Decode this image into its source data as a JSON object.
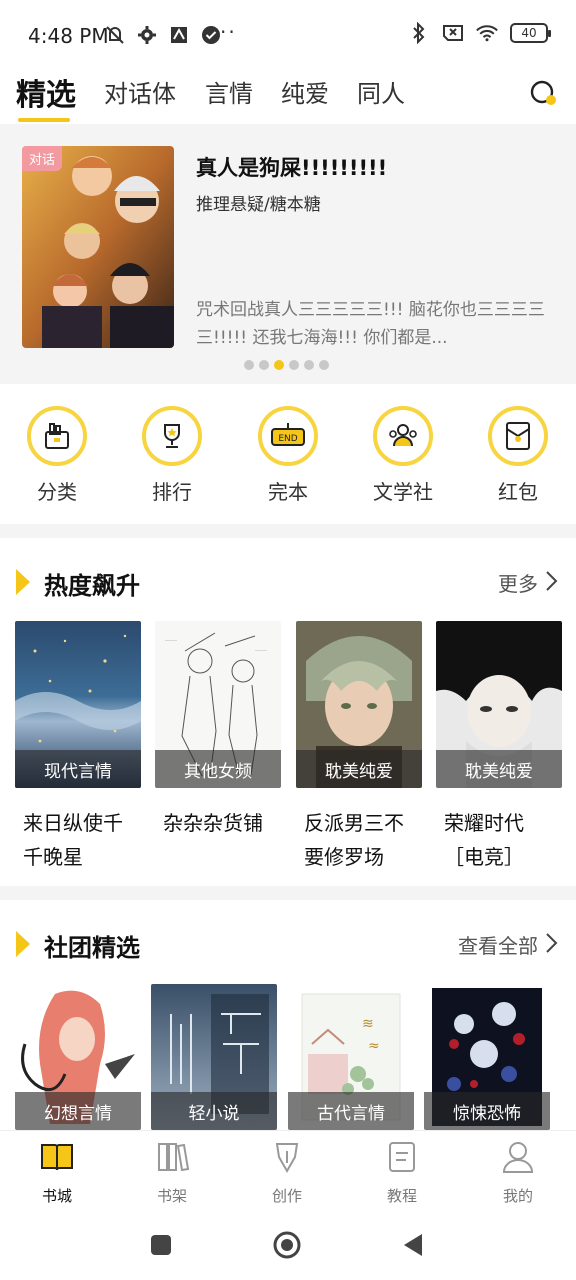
{
  "status_bar": {
    "time": "4:48 PM",
    "battery": "40",
    "more": "··"
  },
  "tabs": [
    {
      "label": "精选",
      "active": true
    },
    {
      "label": "对话体"
    },
    {
      "label": "言情"
    },
    {
      "label": "纯爱"
    },
    {
      "label": "同人"
    }
  ],
  "banner": {
    "tag": "对话",
    "title": "真人是狗屎!!!!!!!!!",
    "subtitle": "推理悬疑/糖本糖",
    "description": "咒术回战真人三三三三三!!! 脑花你也三三三三三!!!!! 还我七海海!!! 你们都是...",
    "page_count": 6,
    "active_page": 2
  },
  "quick_entries": [
    {
      "label": "分类",
      "icon": "category-bag-icon"
    },
    {
      "label": "排行",
      "icon": "trophy-icon"
    },
    {
      "label": "完本",
      "icon": "end-sign-icon"
    },
    {
      "label": "文学社",
      "icon": "club-people-icon"
    },
    {
      "label": "红包",
      "icon": "red-envelope-icon"
    }
  ],
  "hot_section": {
    "title": "热度飙升",
    "more": "更多",
    "books": [
      {
        "category": "现代言情",
        "title": "来日纵使千千晚星"
      },
      {
        "category": "其他女频",
        "title": "杂杂杂货铺"
      },
      {
        "category": "耽美纯爱",
        "title": "反派男三不要修罗场"
      },
      {
        "category": "耽美纯爱",
        "title": "荣耀时代［电竞］"
      }
    ]
  },
  "club_section": {
    "title": "社团精选",
    "more": "查看全部",
    "books": [
      {
        "category": "幻想言情"
      },
      {
        "category": "轻小说"
      },
      {
        "category": "古代言情"
      },
      {
        "category": "惊悚恐怖"
      }
    ]
  },
  "bottom_nav": [
    {
      "label": "书城",
      "active": true,
      "icon": "book-open-icon"
    },
    {
      "label": "书架",
      "icon": "bookshelf-icon"
    },
    {
      "label": "创作",
      "icon": "pen-icon"
    },
    {
      "label": "教程",
      "icon": "document-icon"
    },
    {
      "label": "我的",
      "icon": "person-icon"
    }
  ],
  "colors": {
    "accent": "#f5c518",
    "tag_pink": "#f39aa0",
    "section_bg": "#f4f4f4"
  }
}
